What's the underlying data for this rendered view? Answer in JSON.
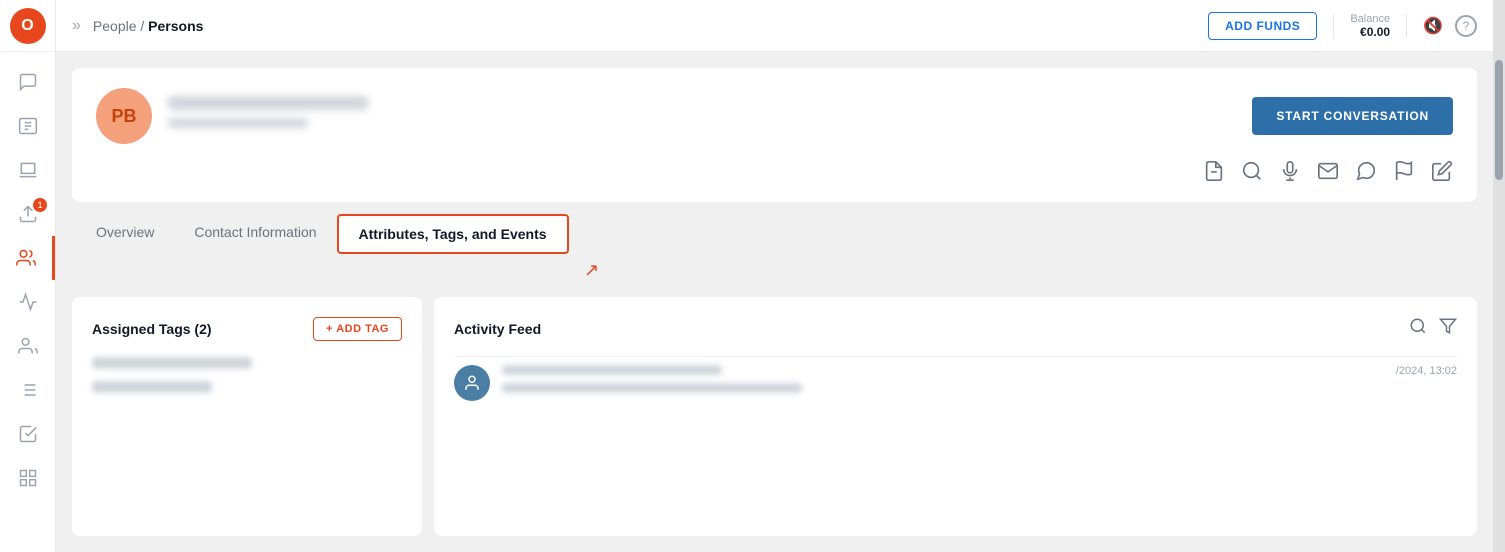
{
  "logo": {
    "text": "O",
    "color": "#e8471e"
  },
  "header": {
    "breadcrumb_separator": "People /",
    "breadcrumb_current": "Persons",
    "add_funds_label": "ADD FUNDS",
    "balance_label": "Balance",
    "balance_amount": "€0.00",
    "collapse_icon": "»"
  },
  "profile": {
    "avatar_text": "PB",
    "start_conversation_label": "START CONVERSATION"
  },
  "tabs": [
    {
      "label": "Overview",
      "active": false
    },
    {
      "label": "Contact Information",
      "active": false
    },
    {
      "label": "Attributes, Tags, and Events",
      "active": true
    }
  ],
  "tags_panel": {
    "title": "Assigned Tags (2)",
    "add_tag_label": "+ ADD TAG"
  },
  "activity_panel": {
    "title": "Activity Feed",
    "timestamp": "/2024, 13:02"
  },
  "sidebar": {
    "items": [
      {
        "name": "inbox",
        "icon": "💬",
        "active": false
      },
      {
        "name": "contacts",
        "icon": "👤",
        "active": false
      },
      {
        "name": "campaigns",
        "icon": "📋",
        "active": false
      },
      {
        "name": "reports",
        "icon": "📥",
        "active": false,
        "badge": "1"
      },
      {
        "name": "people",
        "icon": "👥",
        "active": true
      },
      {
        "name": "analytics",
        "icon": "📈",
        "active": false
      },
      {
        "name": "segments",
        "icon": "👥",
        "active": false
      },
      {
        "name": "lists",
        "icon": "📄",
        "active": false
      },
      {
        "name": "workflows",
        "icon": "📋",
        "active": false
      },
      {
        "name": "more",
        "icon": "📊",
        "active": false
      }
    ]
  }
}
